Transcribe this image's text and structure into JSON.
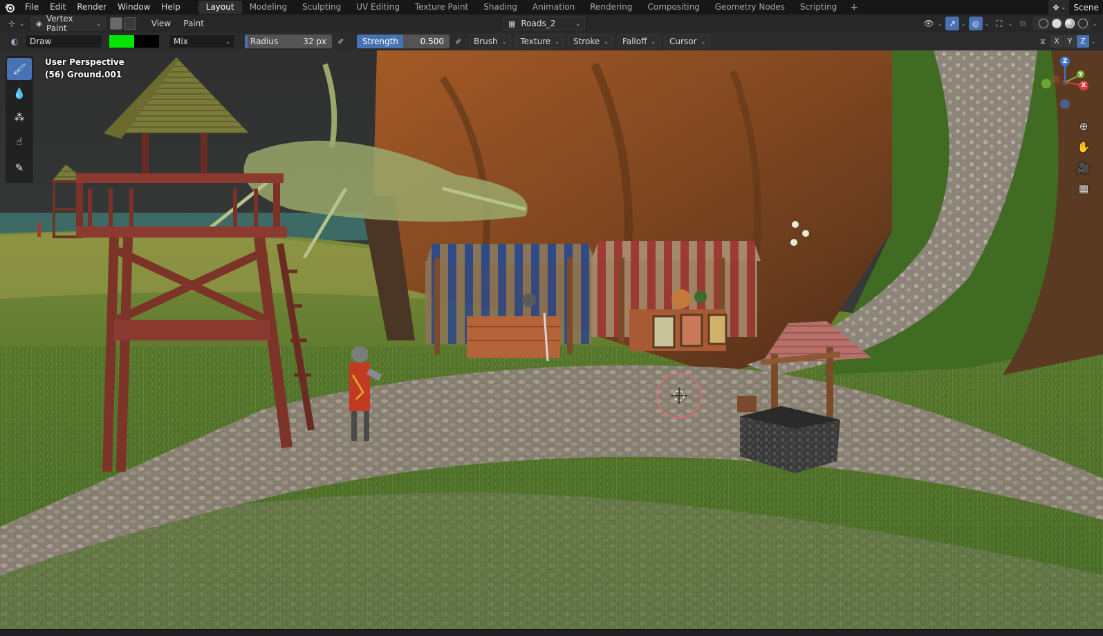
{
  "app": {
    "logo_icon": "blender-logo-icon",
    "menus": [
      "File",
      "Edit",
      "Render",
      "Window",
      "Help"
    ]
  },
  "workspaces": {
    "tabs": [
      {
        "label": "Layout",
        "active": true
      },
      {
        "label": "Modeling",
        "active": false
      },
      {
        "label": "Sculpting",
        "active": false
      },
      {
        "label": "UV Editing",
        "active": false
      },
      {
        "label": "Texture Paint",
        "active": false
      },
      {
        "label": "Shading",
        "active": false
      },
      {
        "label": "Animation",
        "active": false
      },
      {
        "label": "Rendering",
        "active": false
      },
      {
        "label": "Compositing",
        "active": false
      },
      {
        "label": "Geometry Nodes",
        "active": false
      },
      {
        "label": "Scripting",
        "active": false
      }
    ],
    "add_symbol": "+"
  },
  "scene": {
    "label": "Scene"
  },
  "viewport_header": {
    "mode": "Vertex Paint",
    "menus": [
      "View",
      "Paint"
    ],
    "active_object": "Roads_2"
  },
  "tool_settings": {
    "brush": "Draw",
    "primary_color": "#00e600",
    "secondary_color": "#000000",
    "blend_mode": "Mix",
    "radius_label": "Radius",
    "radius_value": "32 px",
    "strength_label": "Strength",
    "strength_value": "0.500",
    "strength_fraction": 0.5,
    "popovers": [
      "Brush",
      "Texture",
      "Stroke",
      "Falloff",
      "Cursor"
    ],
    "symmetry_axes": [
      {
        "label": "X",
        "active": false
      },
      {
        "label": "Y",
        "active": false
      },
      {
        "label": "Z",
        "active": true
      }
    ]
  },
  "viewport": {
    "perspective_label": "User Perspective",
    "object_label": "(56) Ground.001",
    "gizmo_axes": {
      "z": "Z",
      "x": "X",
      "y": "Y"
    },
    "axis_colors": {
      "x": "#e03c3c",
      "y": "#7fb33b",
      "z": "#3c78d8"
    },
    "tools": [
      {
        "name": "draw-brush-tool",
        "glyph": "🖌",
        "active": true
      },
      {
        "name": "blur-tool",
        "glyph": "💧",
        "active": false
      },
      {
        "name": "average-tool",
        "glyph": "⁂",
        "active": false
      },
      {
        "name": "smear-tool",
        "glyph": "☝",
        "active": false
      },
      {
        "name": "annotate-tool",
        "glyph": "✎",
        "active": false
      }
    ]
  }
}
